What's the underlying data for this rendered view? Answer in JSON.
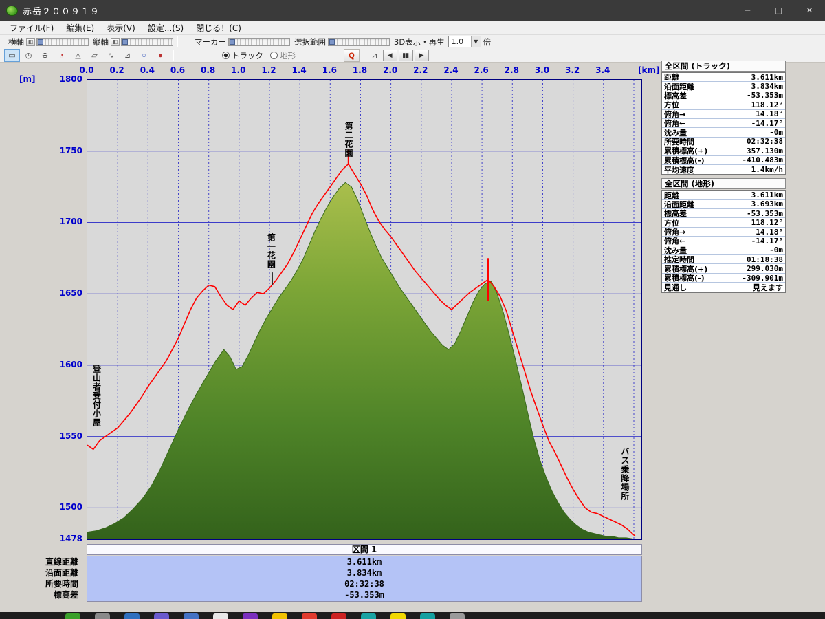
{
  "window": {
    "title": "赤岳２００９１９",
    "controls": {
      "minimize": "─",
      "maximize": "□",
      "close": "✕"
    }
  },
  "menu": {
    "items": [
      "ファイル(F)",
      "編集(E)",
      "表示(V)",
      "設定...(S)",
      "閉じる！(C)"
    ]
  },
  "toolbar": {
    "haxis_label": "横軸",
    "vaxis_label": "縦軸",
    "marker_label": "マーカー",
    "selection_label": "選択範囲",
    "playback_label": "3D表示・再生",
    "speed_value": "1.0",
    "speed_unit": "倍",
    "radio_track": "トラック",
    "radio_terrain": "地形",
    "radio_selected": "トラック",
    "tools": [
      {
        "name": "distance-ruler-icon",
        "glyph": "▭",
        "active": true
      },
      {
        "name": "clock-icon",
        "glyph": "◷",
        "active": false
      },
      {
        "name": "compass-icon",
        "glyph": "⊕",
        "active": false
      },
      {
        "name": "pie-icon",
        "glyph": "◔",
        "color": "#c03030",
        "active": false
      },
      {
        "name": "profile-icon",
        "glyph": "△",
        "active": false
      },
      {
        "name": "area-icon",
        "glyph": "▱",
        "active": false
      },
      {
        "name": "wave-icon",
        "glyph": "∿",
        "active": false
      },
      {
        "name": "slope-icon",
        "glyph": "⊿",
        "active": false
      },
      {
        "name": "drop-icon",
        "glyph": "○",
        "color": "#3355bb",
        "active": false
      },
      {
        "name": "stamp-icon",
        "glyph": "●",
        "color": "#bb3333",
        "active": false
      }
    ],
    "marker_erase_glyph": "Q",
    "gradient_glyph": "⊿",
    "playback_buttons": [
      {
        "name": "step-back-button",
        "glyph": "◀"
      },
      {
        "name": "pause-button",
        "glyph": "▮▮"
      },
      {
        "name": "play-button",
        "glyph": "▶"
      }
    ]
  },
  "chart_data": {
    "type": "area",
    "title": "",
    "x_unit": "[km]",
    "y_unit": "[m]",
    "xlim": [
      0,
      3.65
    ],
    "ylim": [
      1478,
      1800
    ],
    "x_tick_step": 0.2,
    "x_tick_labels": [
      "0.0",
      "0.2",
      "0.4",
      "0.6",
      "0.8",
      "1.0",
      "1.2",
      "1.4",
      "1.6",
      "1.8",
      "2.0",
      "2.2",
      "2.4",
      "2.6",
      "2.8",
      "3.0",
      "3.2",
      "3.4"
    ],
    "y_ticks": [
      1800,
      1750,
      1700,
      1650,
      1600,
      1550,
      1500,
      1478
    ],
    "y_gridlines": [
      1750,
      1700,
      1650,
      1600,
      1550,
      1500
    ],
    "grid_color": "#2b2bc8",
    "plot_bg": "#d9d9d9",
    "annotations": [
      {
        "text": "登山者受付小屋",
        "km": 0.07,
        "top_elev": 1600
      },
      {
        "text": "第一花園",
        "km": 1.22,
        "top_elev": 1692
      },
      {
        "text": "第二花園",
        "km": 1.73,
        "top_elev": 1770
      },
      {
        "text": "バス乗降場所",
        "km": 3.55,
        "top_elev": 1542
      }
    ],
    "leaders": [
      {
        "km": 1.22,
        "from": 1665,
        "to": 1656
      }
    ],
    "markers": [
      {
        "km": 1.72,
        "from": 1741,
        "to": 1751
      },
      {
        "km": 2.64,
        "from": 1645,
        "to": 1675
      }
    ],
    "series": [
      {
        "name": "terrain",
        "render": "area",
        "outline_color": "#38691c",
        "gradient": [
          "#b7c653",
          "#7da637",
          "#4f8428",
          "#33621b"
        ],
        "points": [
          [
            0.0,
            1483
          ],
          [
            0.06,
            1484
          ],
          [
            0.12,
            1486
          ],
          [
            0.18,
            1489
          ],
          [
            0.24,
            1493
          ],
          [
            0.3,
            1499
          ],
          [
            0.36,
            1506
          ],
          [
            0.42,
            1515
          ],
          [
            0.48,
            1527
          ],
          [
            0.54,
            1541
          ],
          [
            0.6,
            1555
          ],
          [
            0.66,
            1568
          ],
          [
            0.72,
            1580
          ],
          [
            0.78,
            1591
          ],
          [
            0.84,
            1602
          ],
          [
            0.9,
            1611
          ],
          [
            0.94,
            1606
          ],
          [
            0.98,
            1597
          ],
          [
            1.02,
            1599
          ],
          [
            1.06,
            1607
          ],
          [
            1.1,
            1616
          ],
          [
            1.14,
            1625
          ],
          [
            1.18,
            1633
          ],
          [
            1.22,
            1640
          ],
          [
            1.26,
            1647
          ],
          [
            1.3,
            1653
          ],
          [
            1.34,
            1659
          ],
          [
            1.38,
            1666
          ],
          [
            1.42,
            1674
          ],
          [
            1.46,
            1684
          ],
          [
            1.5,
            1694
          ],
          [
            1.54,
            1703
          ],
          [
            1.58,
            1711
          ],
          [
            1.62,
            1718
          ],
          [
            1.66,
            1724
          ],
          [
            1.7,
            1728
          ],
          [
            1.74,
            1725
          ],
          [
            1.78,
            1716
          ],
          [
            1.82,
            1705
          ],
          [
            1.86,
            1694
          ],
          [
            1.9,
            1684
          ],
          [
            1.94,
            1675
          ],
          [
            1.98,
            1668
          ],
          [
            2.02,
            1661
          ],
          [
            2.06,
            1654
          ],
          [
            2.1,
            1648
          ],
          [
            2.14,
            1642
          ],
          [
            2.18,
            1636
          ],
          [
            2.22,
            1630
          ],
          [
            2.26,
            1624
          ],
          [
            2.3,
            1619
          ],
          [
            2.34,
            1614
          ],
          [
            2.38,
            1611
          ],
          [
            2.42,
            1615
          ],
          [
            2.46,
            1624
          ],
          [
            2.5,
            1634
          ],
          [
            2.54,
            1644
          ],
          [
            2.58,
            1652
          ],
          [
            2.62,
            1657
          ],
          [
            2.66,
            1659
          ],
          [
            2.7,
            1650
          ],
          [
            2.74,
            1637
          ],
          [
            2.78,
            1621
          ],
          [
            2.82,
            1604
          ],
          [
            2.86,
            1586
          ],
          [
            2.9,
            1567
          ],
          [
            2.94,
            1549
          ],
          [
            2.98,
            1534
          ],
          [
            3.02,
            1522
          ],
          [
            3.06,
            1512
          ],
          [
            3.1,
            1504
          ],
          [
            3.14,
            1497
          ],
          [
            3.18,
            1492
          ],
          [
            3.22,
            1488
          ],
          [
            3.26,
            1485
          ],
          [
            3.3,
            1483
          ],
          [
            3.34,
            1482
          ],
          [
            3.38,
            1481
          ],
          [
            3.42,
            1480
          ],
          [
            3.46,
            1480
          ],
          [
            3.5,
            1479
          ],
          [
            3.55,
            1479
          ],
          [
            3.61,
            1478
          ]
        ]
      },
      {
        "name": "track",
        "render": "line",
        "color": "#ff0000",
        "points": [
          [
            0.0,
            1544
          ],
          [
            0.04,
            1541
          ],
          [
            0.08,
            1547
          ],
          [
            0.12,
            1550
          ],
          [
            0.16,
            1553
          ],
          [
            0.2,
            1556
          ],
          [
            0.24,
            1561
          ],
          [
            0.28,
            1566
          ],
          [
            0.32,
            1572
          ],
          [
            0.36,
            1578
          ],
          [
            0.4,
            1585
          ],
          [
            0.44,
            1591
          ],
          [
            0.48,
            1597
          ],
          [
            0.52,
            1603
          ],
          [
            0.56,
            1611
          ],
          [
            0.6,
            1619
          ],
          [
            0.64,
            1629
          ],
          [
            0.68,
            1639
          ],
          [
            0.72,
            1647
          ],
          [
            0.76,
            1652
          ],
          [
            0.8,
            1656
          ],
          [
            0.84,
            1655
          ],
          [
            0.88,
            1648
          ],
          [
            0.92,
            1642
          ],
          [
            0.96,
            1639
          ],
          [
            1.0,
            1645
          ],
          [
            1.04,
            1642
          ],
          [
            1.08,
            1647
          ],
          [
            1.12,
            1651
          ],
          [
            1.16,
            1650
          ],
          [
            1.2,
            1654
          ],
          [
            1.24,
            1659
          ],
          [
            1.28,
            1665
          ],
          [
            1.32,
            1671
          ],
          [
            1.36,
            1679
          ],
          [
            1.4,
            1688
          ],
          [
            1.44,
            1697
          ],
          [
            1.48,
            1706
          ],
          [
            1.52,
            1713
          ],
          [
            1.56,
            1719
          ],
          [
            1.6,
            1725
          ],
          [
            1.64,
            1731
          ],
          [
            1.68,
            1737
          ],
          [
            1.72,
            1741
          ],
          [
            1.76,
            1734
          ],
          [
            1.8,
            1727
          ],
          [
            1.84,
            1719
          ],
          [
            1.88,
            1709
          ],
          [
            1.92,
            1701
          ],
          [
            1.96,
            1695
          ],
          [
            2.0,
            1690
          ],
          [
            2.04,
            1684
          ],
          [
            2.08,
            1678
          ],
          [
            2.12,
            1672
          ],
          [
            2.16,
            1666
          ],
          [
            2.2,
            1661
          ],
          [
            2.24,
            1656
          ],
          [
            2.28,
            1651
          ],
          [
            2.32,
            1646
          ],
          [
            2.36,
            1642
          ],
          [
            2.4,
            1639
          ],
          [
            2.44,
            1643
          ],
          [
            2.48,
            1647
          ],
          [
            2.52,
            1651
          ],
          [
            2.56,
            1654
          ],
          [
            2.6,
            1657
          ],
          [
            2.64,
            1660
          ],
          [
            2.68,
            1655
          ],
          [
            2.72,
            1648
          ],
          [
            2.76,
            1638
          ],
          [
            2.8,
            1624
          ],
          [
            2.84,
            1610
          ],
          [
            2.88,
            1596
          ],
          [
            2.92,
            1582
          ],
          [
            2.96,
            1570
          ],
          [
            3.0,
            1558
          ],
          [
            3.04,
            1547
          ],
          [
            3.08,
            1539
          ],
          [
            3.12,
            1530
          ],
          [
            3.16,
            1521
          ],
          [
            3.2,
            1513
          ],
          [
            3.24,
            1506
          ],
          [
            3.28,
            1500
          ],
          [
            3.32,
            1497
          ],
          [
            3.36,
            1496
          ],
          [
            3.4,
            1494
          ],
          [
            3.44,
            1492
          ],
          [
            3.48,
            1490
          ],
          [
            3.52,
            1488
          ],
          [
            3.56,
            1485
          ],
          [
            3.61,
            1480
          ]
        ]
      }
    ]
  },
  "panels": {
    "track": {
      "title": "全区間 (トラック)",
      "rows": [
        [
          "距離",
          "3.611km"
        ],
        [
          "沿面距離",
          "3.834km"
        ],
        [
          "標高差",
          "-53.353m"
        ],
        [
          "方位",
          "118.12°"
        ],
        [
          "俯角→",
          "14.18°"
        ],
        [
          "俯角←",
          "-14.17°"
        ],
        [
          "沈み量",
          "-0m"
        ],
        [
          "所要時間",
          "02:32:38"
        ],
        [
          "累積標高(+)",
          "357.130m"
        ],
        [
          "累積標高(-)",
          "-410.483m"
        ],
        [
          "平均速度",
          "1.4km/h"
        ]
      ]
    },
    "terrain": {
      "title": "全区間 (地形)",
      "rows": [
        [
          "距離",
          "3.611km"
        ],
        [
          "沿面距離",
          "3.693km"
        ],
        [
          "標高差",
          "-53.353m"
        ],
        [
          "方位",
          "118.12°"
        ],
        [
          "俯角→",
          "14.18°"
        ],
        [
          "俯角←",
          "-14.17°"
        ],
        [
          "沈み量",
          "-0m"
        ],
        [
          "推定時間",
          "01:18:38"
        ],
        [
          "累積標高(+)",
          "299.030m"
        ],
        [
          "累積標高(-)",
          "-309.901m"
        ],
        [
          "見通し",
          "見えます"
        ]
      ]
    }
  },
  "section_panel": {
    "title": "区間 1",
    "rows": [
      [
        "直線距離",
        "3.611km"
      ],
      [
        "沿面距離",
        "3.834km"
      ],
      [
        "所要時間",
        "02:32:38"
      ],
      [
        "標高差",
        "-53.353m"
      ]
    ]
  },
  "taskbar": {
    "icon_colors": [
      "#3aa02a",
      "#8a8a8a",
      "#2f6fbe",
      "#6a5acd",
      "#4472c4",
      "#e8e8e8",
      "#7b2fbe",
      "#f2c200",
      "#e23b2e",
      "#cc2222",
      "#19a3a3",
      "#f2d800",
      "#13a0a0",
      "#9a9a9a"
    ]
  }
}
